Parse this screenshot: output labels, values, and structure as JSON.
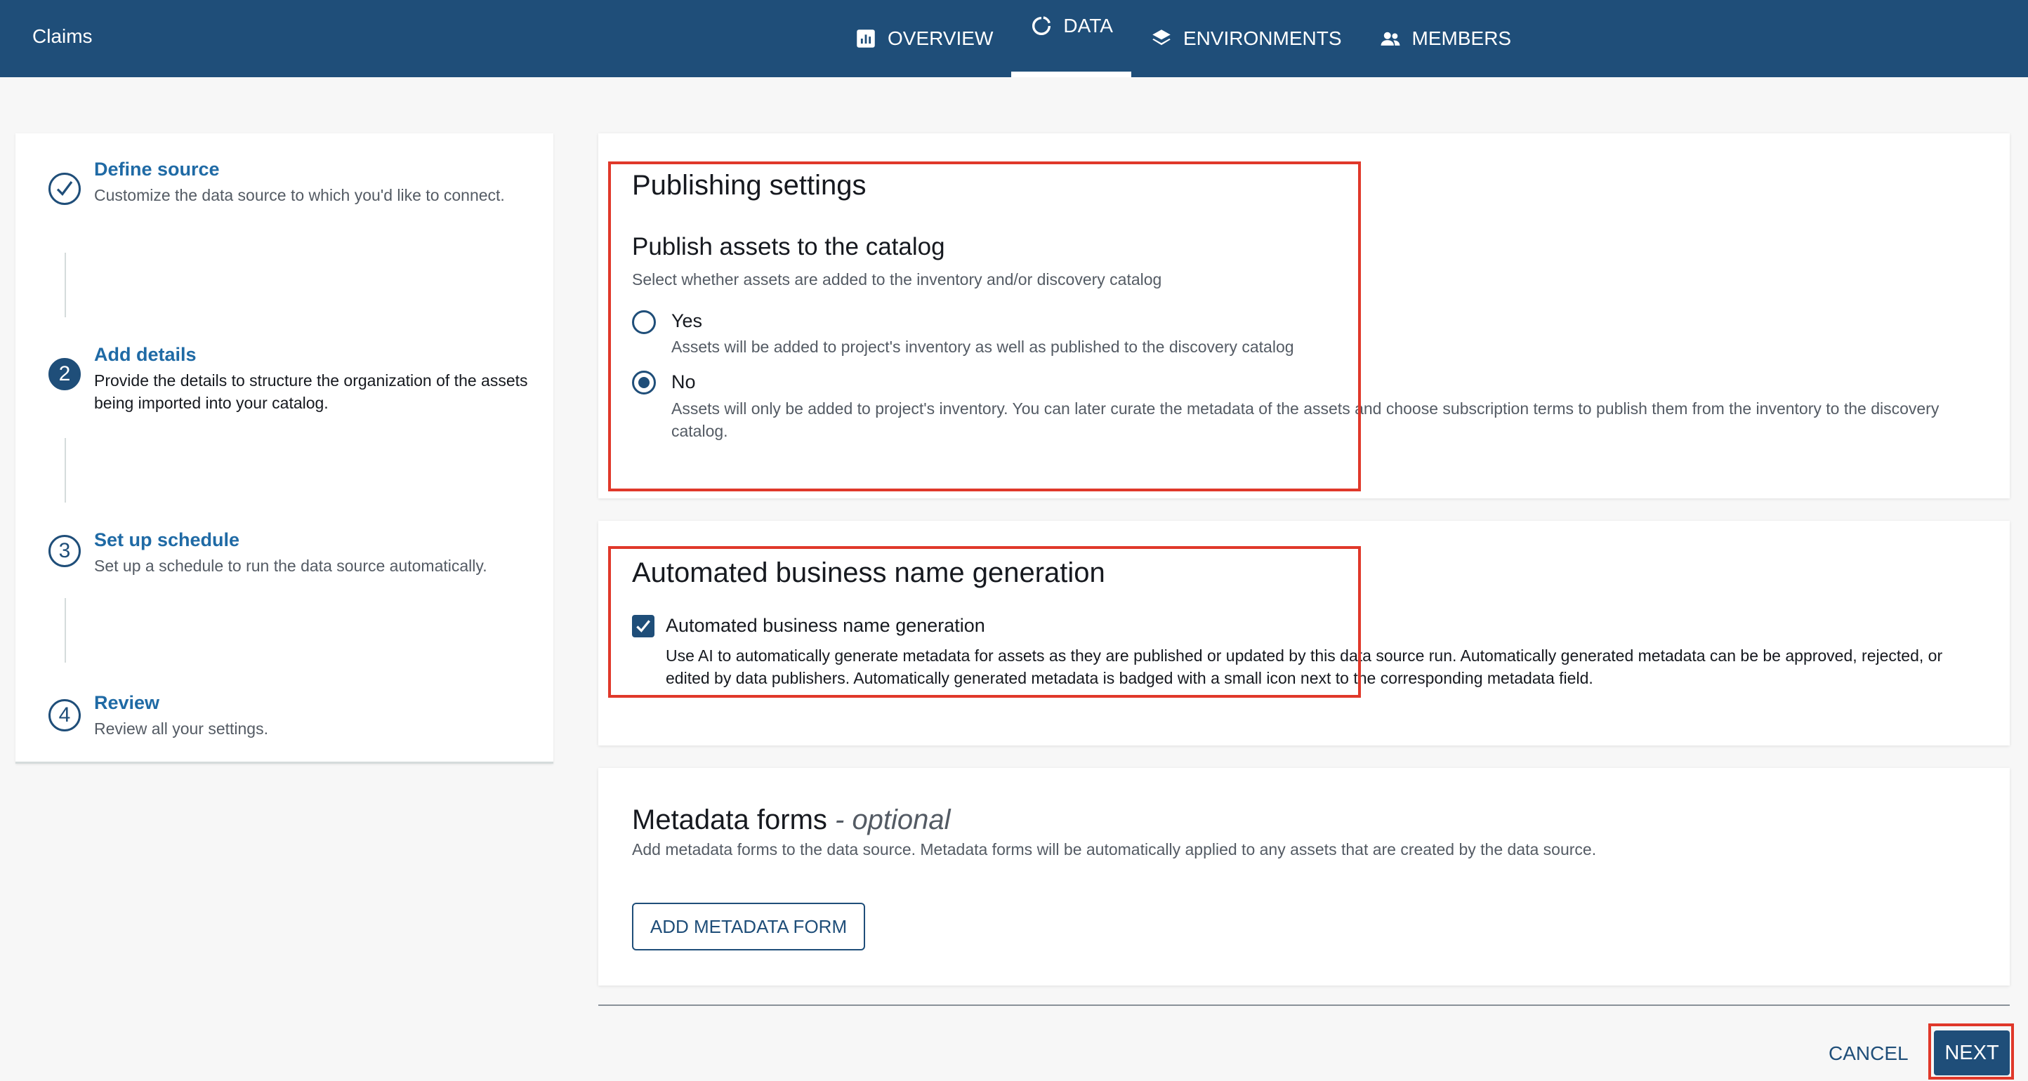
{
  "header": {
    "project_name": "Claims",
    "tabs": [
      {
        "label": "OVERVIEW",
        "icon": "bar-chart-icon"
      },
      {
        "label": "DATA",
        "icon": "refresh-icon",
        "active": true
      },
      {
        "label": "ENVIRONMENTS",
        "icon": "layers-icon"
      },
      {
        "label": "MEMBERS",
        "icon": "people-icon"
      }
    ]
  },
  "stepper": {
    "steps": [
      {
        "marker": "✓",
        "title": "Define source",
        "description": "Customize the data source to which you'd like to connect.",
        "status": "completed"
      },
      {
        "marker": "2",
        "title": "Add details",
        "description": "Provide the details to structure the organization of the assets being imported into your catalog.",
        "status": "current"
      },
      {
        "marker": "3",
        "title": "Set up schedule",
        "description": "Set up a schedule to run the data source automatically.",
        "status": "upcoming"
      },
      {
        "marker": "4",
        "title": "Review",
        "description": "Review all your settings.",
        "status": "upcoming"
      }
    ]
  },
  "publishing": {
    "title": "Publishing settings",
    "subtitle": "Publish assets to the catalog",
    "help": "Select whether assets are added to the inventory and/or discovery catalog",
    "options": [
      {
        "label": "Yes",
        "description": "Assets will be added to project's inventory as well as published to the discovery catalog",
        "checked": false
      },
      {
        "label": "No",
        "description": "Assets will only be added to project's inventory. You can later curate the metadata of the assets and choose subscription terms to publish them from the inventory to the discovery catalog.",
        "checked": true
      }
    ]
  },
  "automated": {
    "title": "Automated business name generation",
    "checkbox_label": "Automated business name generation",
    "checked": true,
    "description": "Use AI to automatically generate metadata for assets as they are published or updated by this data source run. Automatically generated metadata can be be approved, rejected, or edited by data publishers. Automatically generated metadata is badged with a small icon next to the corresponding metadata field."
  },
  "metadata_forms": {
    "title": "Metadata forms",
    "optional_suffix": " - optional",
    "description": "Add metadata forms to the data source. Metadata forms will be automatically applied to any assets that are created by the data source.",
    "add_button": "ADD METADATA FORM"
  },
  "footer": {
    "cancel": "CANCEL",
    "next": "NEXT"
  },
  "colors": {
    "header_bg": "#1f4e79",
    "accent": "#1f4e79",
    "link": "#1f6aa5",
    "highlight": "#e0382a"
  }
}
